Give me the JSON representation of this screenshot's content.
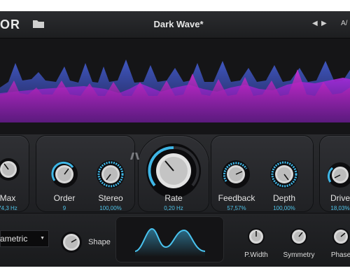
{
  "header": {
    "logo": "OR",
    "preset_name": "Dark Wave*",
    "prev_label": "◀",
    "next_label": "▶",
    "ab_label": "A/"
  },
  "knobs": [
    {
      "label": "Max",
      "value": "74,3 Hz"
    },
    {
      "label": "Order",
      "value": "9"
    },
    {
      "label": "Stereo",
      "value": "100,00%"
    },
    {
      "label": "Rate",
      "value": "0,20 Hz"
    },
    {
      "label": "Feedback",
      "value": "57,57%"
    },
    {
      "label": "Depth",
      "value": "100,00%"
    },
    {
      "label": "Drive",
      "value": "18,03%"
    }
  ],
  "lfo": {
    "shape_dropdown": "ametric",
    "shape_label": "Shape",
    "params": [
      {
        "label": "P.Width"
      },
      {
        "label": "Symmetry"
      },
      {
        "label": "Phase"
      }
    ]
  },
  "colors": {
    "accent_blue": "#3fb6e6",
    "wave_purple": "#8e24c9",
    "wave_blue": "#3a55c8",
    "wave_magenta": "#c41fb8"
  },
  "icons": {
    "folder": "folder-icon",
    "lfo_sync": "lfo-sync-icon"
  }
}
